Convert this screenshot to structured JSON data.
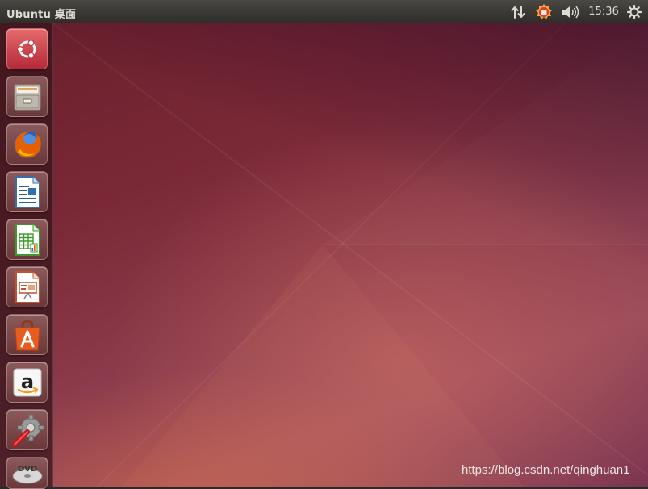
{
  "panel": {
    "title": "Ubuntu 桌面",
    "clock": "15:36",
    "indicators": [
      "network-icon",
      "input-method-icon",
      "sound-icon",
      "session-gear-icon"
    ]
  },
  "launcher": {
    "items": [
      {
        "name": "dash-home",
        "icon": "ubuntu-logo-icon",
        "color": "#dd4814"
      },
      {
        "name": "files",
        "icon": "file-cabinet-icon",
        "color": "#d6d0c6"
      },
      {
        "name": "firefox",
        "icon": "firefox-icon",
        "color": "#e66000"
      },
      {
        "name": "libreoffice-writer",
        "icon": "writer-document-icon",
        "color": "#2a6fb3"
      },
      {
        "name": "libreoffice-calc",
        "icon": "calc-spreadsheet-icon",
        "color": "#3c9a2a"
      },
      {
        "name": "libreoffice-impress",
        "icon": "impress-presentation-icon",
        "color": "#c0522e"
      },
      {
        "name": "ubuntu-software-center",
        "icon": "shopping-bag-a-icon",
        "color": "#e55d1f"
      },
      {
        "name": "amazon",
        "icon": "amazon-a-icon",
        "color": "#ffffff"
      },
      {
        "name": "system-settings",
        "icon": "wrench-gear-icon",
        "color": "#8a8a8a"
      },
      {
        "name": "dvd",
        "icon": "dvd-disc-icon",
        "color": "#cfcfcf"
      }
    ]
  },
  "desktop": {
    "watermark": "https://blog.csdn.net/qinghuan1"
  }
}
